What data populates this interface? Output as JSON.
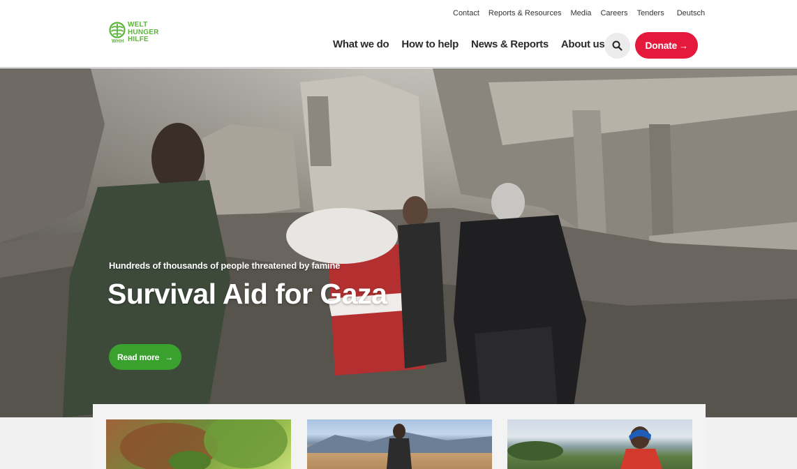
{
  "brand": {
    "logo_lines": [
      "WELT",
      "HUNGER",
      "HILFE"
    ],
    "logo_abbr": "WHH",
    "color": "#5cb53a"
  },
  "topnav": [
    "Contact",
    "Reports & Resources",
    "Media",
    "Careers",
    "Tenders",
    "Deutsch"
  ],
  "mainnav": [
    "What we do",
    "How to help",
    "News & Reports",
    "About us"
  ],
  "search": {
    "icon": "search-icon"
  },
  "donate": {
    "label": "Donate",
    "icon": "arrow-right-icon",
    "color": "#e4193c"
  },
  "hero": {
    "kicker": "Hundreds of thousands of people threatened by famine",
    "title": "Survival Aid for Gaza",
    "cta": "Read more",
    "cta_icon": "arrow-right-icon",
    "cta_color": "#3aa02e"
  },
  "cards": [
    {
      "image": "hands-with-vegetables-photo"
    },
    {
      "image": "man-in-field-mountains-photo"
    },
    {
      "image": "woman-in-blue-headscarf-photo"
    }
  ]
}
